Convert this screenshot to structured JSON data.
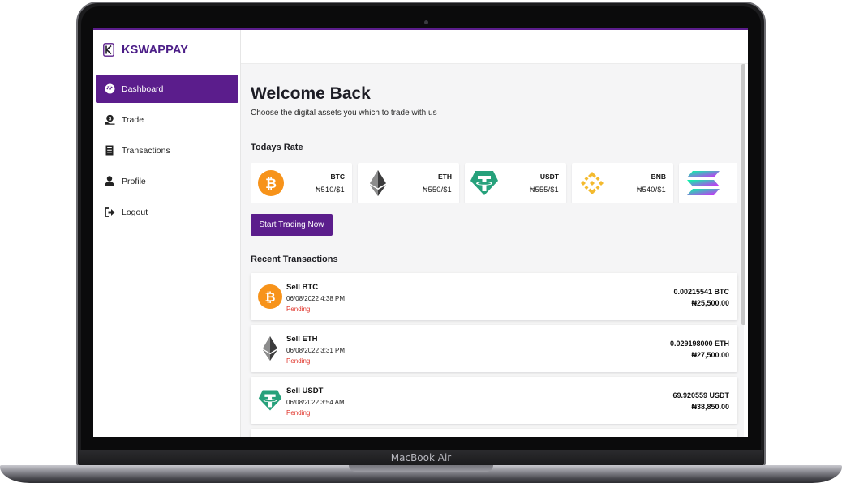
{
  "device": {
    "label": "MacBook Air"
  },
  "sidebar": {
    "brand": "KSWAPPAY",
    "items": [
      {
        "label": "Dashboard",
        "icon": "gauge-icon",
        "active": true
      },
      {
        "label": "Trade",
        "icon": "coin-hand-icon",
        "active": false
      },
      {
        "label": "Transactions",
        "icon": "receipt-icon",
        "active": false
      },
      {
        "label": "Profile",
        "icon": "user-icon",
        "active": false
      },
      {
        "label": "Logout",
        "icon": "logout-icon",
        "active": false
      }
    ]
  },
  "main": {
    "title": "Welcome Back",
    "subtitle": "Choose the digital assets you which to trade with us",
    "rates_title": "Todays Rate",
    "rates": [
      {
        "symbol": "BTC",
        "price": "₦510/$1",
        "icon": "bitcoin-icon"
      },
      {
        "symbol": "ETH",
        "price": "₦550/$1",
        "icon": "ethereum-icon"
      },
      {
        "symbol": "USDT",
        "price": "₦555/$1",
        "icon": "tether-icon"
      },
      {
        "symbol": "BNB",
        "price": "₦540/$1",
        "icon": "binance-icon"
      },
      {
        "symbol": "",
        "price": "",
        "icon": "solana-icon"
      }
    ],
    "cta": "Start Trading Now",
    "transactions_title": "Recent Transactions",
    "transactions": [
      {
        "title": "Sell BTC",
        "date": "06/08/2022 4:38 PM",
        "status": "Pending",
        "amount": "0.00215541 BTC",
        "naira": "₦25,500.00",
        "icon": "bitcoin-icon"
      },
      {
        "title": "Sell ETH",
        "date": "06/08/2022 3:31 PM",
        "status": "Pending",
        "amount": "0.029198000 ETH",
        "naira": "₦27,500.00",
        "icon": "ethereum-icon"
      },
      {
        "title": "Sell USDT",
        "date": "06/08/2022 3:54 AM",
        "status": "Pending",
        "amount": "69.920559 USDT",
        "naira": "₦38,850.00",
        "icon": "tether-icon"
      }
    ]
  },
  "colors": {
    "brand": "#5b1d8c",
    "pending": "#e0352b",
    "bitcoin": "#f7931a",
    "tether": "#26a17b",
    "binance": "#f3ba2f"
  }
}
